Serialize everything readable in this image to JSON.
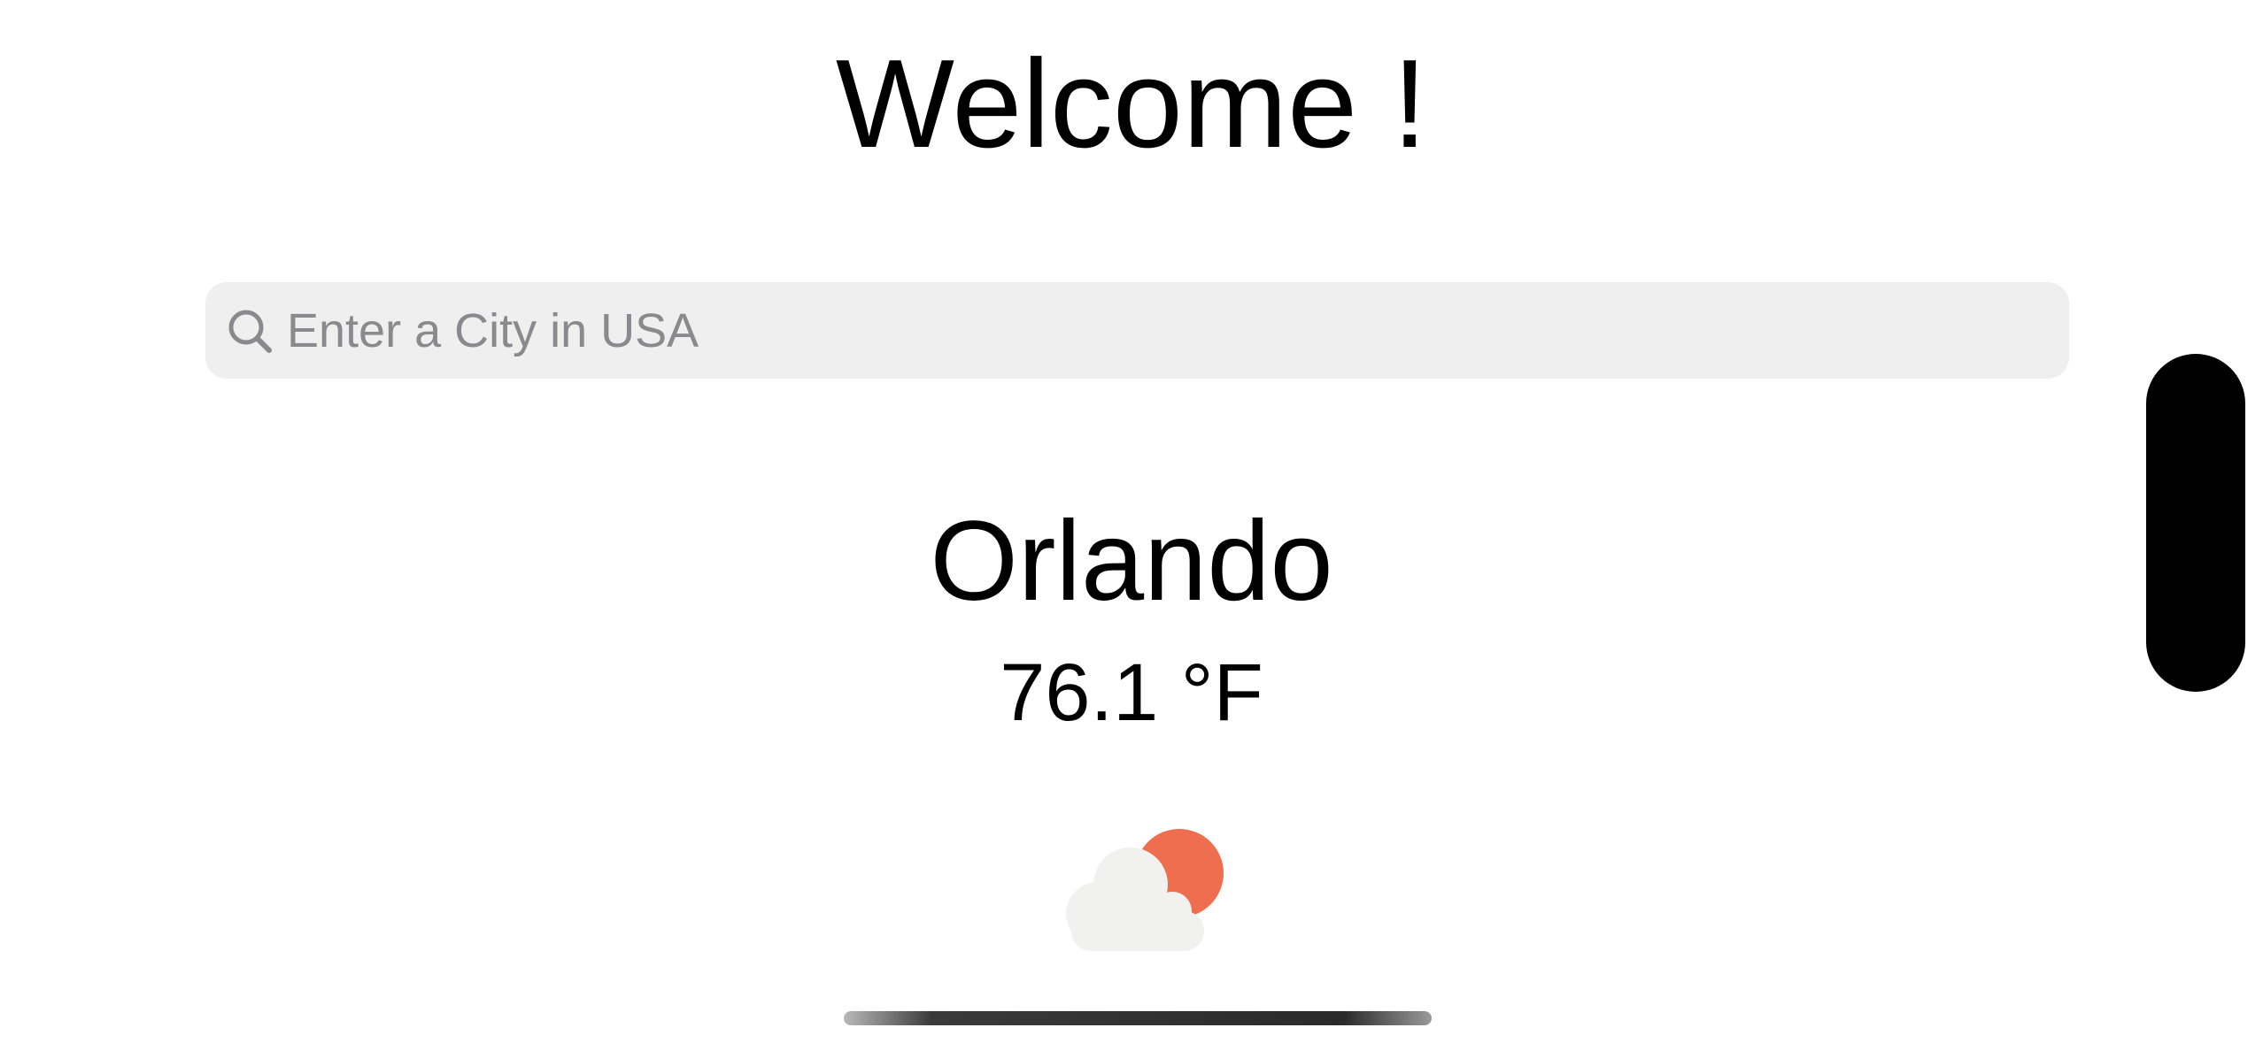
{
  "header": {
    "title": "Welcome !"
  },
  "search": {
    "placeholder": "Enter a City in USA",
    "value": "",
    "icon": "search-icon"
  },
  "weather": {
    "city": "Orlando",
    "temperature": "76.1 °F",
    "icon": "partly-cloudy-icon",
    "sun_color": "#ee6e4f",
    "cloud_color": "#f1f1f0"
  },
  "colors": {
    "background": "#ffffff",
    "search_background": "#efefef",
    "placeholder": "#8a8a8e"
  }
}
